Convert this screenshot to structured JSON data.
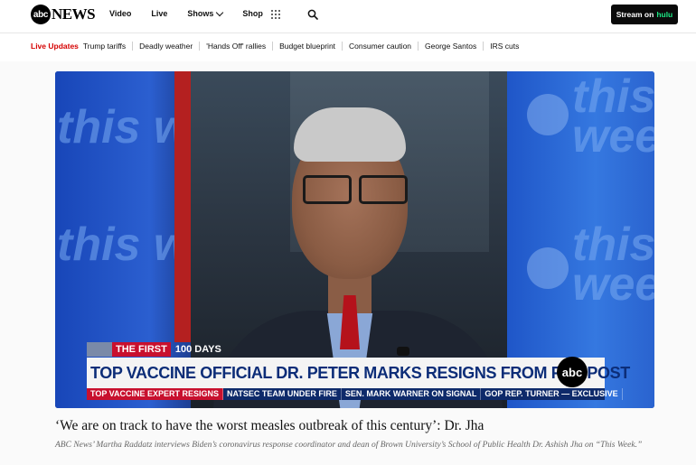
{
  "header": {
    "logo_abc": "abc",
    "logo_news": "NEWS",
    "nav": [
      {
        "label": "Video"
      },
      {
        "label": "Live"
      },
      {
        "label": "Shows"
      },
      {
        "label": "Shop"
      }
    ],
    "stream_prefix": "Stream on",
    "stream_brand": "hulu"
  },
  "live_updates": {
    "label": "Live Updates",
    "items": [
      "Trump tariffs",
      "Deadly weather",
      "'Hands Off' rallies",
      "Budget blueprint",
      "Consumer caution",
      "George Santos",
      "IRS cuts"
    ]
  },
  "video": {
    "chyron_tag": "THE FIRST",
    "chyron_days": "100 DAYS",
    "headline": "TOP VACCINE OFFICIAL DR. PETER MARKS RESIGNS FROM FDA POST",
    "chyron_logo": "abc",
    "ticker": [
      "TOP VACCINE EXPERT RESIGNS",
      "NATSEC TEAM UNDER FIRE",
      "SEN. MARK WARNER ON SIGNAL",
      "GOP REP. TURNER — EXCLUSIVE"
    ],
    "bg_text": "this week"
  },
  "caption": {
    "title": "‘We are on track to have the worst measles outbreak of this century’: Dr. Jha",
    "description": "ABC News’ Martha Raddatz interviews Biden’s coronavirus response coordinator and dean of Brown University’s School of Public Health Dr. Ashish Jha on “This Week.”"
  },
  "colors": {
    "live_red": "#d50000",
    "hulu_green": "#1ce783",
    "chyron_blue": "#0c2d78",
    "chyron_red": "#c8102e"
  },
  "icons": [
    "apps-grid-icon",
    "search-icon",
    "chevron-down-icon"
  ]
}
